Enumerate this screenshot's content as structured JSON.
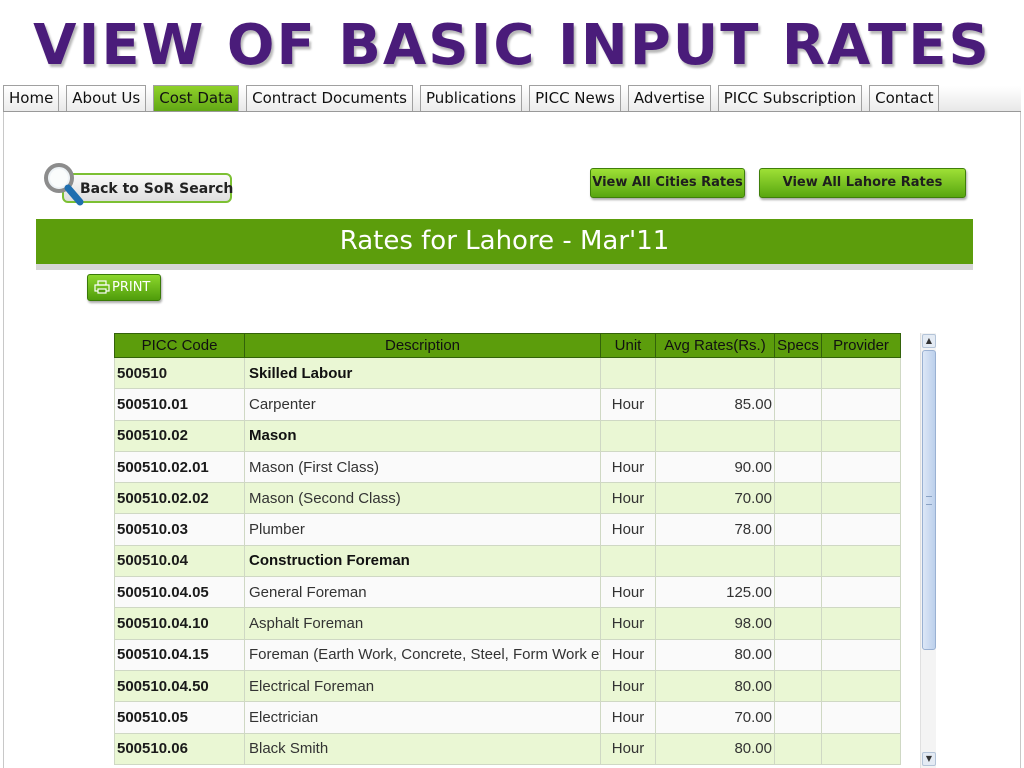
{
  "slide": {
    "title": "VIEW OF BASIC INPUT RATES"
  },
  "nav": {
    "tabs": [
      {
        "label": "Home"
      },
      {
        "label": "About Us"
      },
      {
        "label": "Cost Data",
        "active": true
      },
      {
        "label": "Contract Documents"
      },
      {
        "label": "Publications"
      },
      {
        "label": "PICC News"
      },
      {
        "label": "Advertise"
      },
      {
        "label": "PICC Subscription"
      },
      {
        "label": "Contact"
      }
    ]
  },
  "actions": {
    "back_label": "Back to SoR Search",
    "view_all_cities": "View All Cities Rates",
    "view_all_lahore": "View All Lahore Rates",
    "print_label": "PRINT"
  },
  "rates": {
    "title": "Rates for Lahore - Mar'11",
    "columns": [
      "PICC Code",
      "Description",
      "Unit",
      "Avg Rates(Rs.)",
      "Specs",
      "Provider"
    ],
    "rows": [
      {
        "code": "500510",
        "description": "Skilled Labour",
        "unit": "",
        "rate": "",
        "group": true
      },
      {
        "code": "500510.01",
        "description": "Carpenter",
        "unit": "Hour",
        "rate": "85.00",
        "group": false
      },
      {
        "code": "500510.02",
        "description": "Mason",
        "unit": "",
        "rate": "",
        "group": true
      },
      {
        "code": "500510.02.01",
        "description": "Mason (First Class)",
        "unit": "Hour",
        "rate": "90.00",
        "group": false
      },
      {
        "code": "500510.02.02",
        "description": "Mason (Second Class)",
        "unit": "Hour",
        "rate": "70.00",
        "group": false
      },
      {
        "code": "500510.03",
        "description": "Plumber",
        "unit": "Hour",
        "rate": "78.00",
        "group": false
      },
      {
        "code": "500510.04",
        "description": "Construction Foreman",
        "unit": "",
        "rate": "",
        "group": true
      },
      {
        "code": "500510.04.05",
        "description": "General Foreman",
        "unit": "Hour",
        "rate": "125.00",
        "group": false
      },
      {
        "code": "500510.04.10",
        "description": "Asphalt Foreman",
        "unit": "Hour",
        "rate": "98.00",
        "group": false
      },
      {
        "code": "500510.04.15",
        "description": "Foreman (Earth Work, Concrete, Steel, Form Work etc.)",
        "unit": "Hour",
        "rate": "80.00",
        "group": false
      },
      {
        "code": "500510.04.50",
        "description": "Electrical Foreman",
        "unit": "Hour",
        "rate": "80.00",
        "group": false
      },
      {
        "code": "500510.05",
        "description": "Electrician",
        "unit": "Hour",
        "rate": "70.00",
        "group": false
      },
      {
        "code": "500510.06",
        "description": "Black Smith",
        "unit": "Hour",
        "rate": "80.00",
        "group": false
      }
    ]
  },
  "colors": {
    "title": "#4a1c7a",
    "accent_green": "#5c9d0c",
    "row_highlight": "#eaf7d4",
    "active_tab": "#7ec21f"
  }
}
